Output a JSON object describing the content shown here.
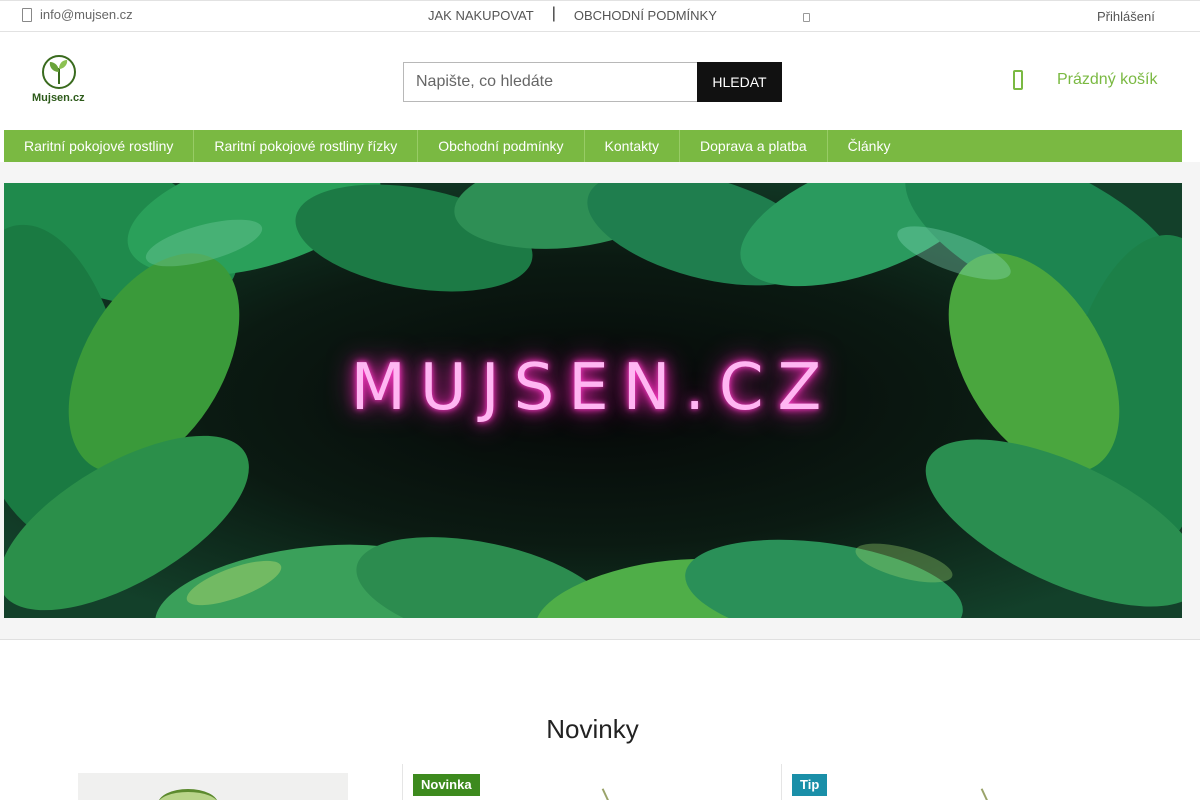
{
  "topbar": {
    "email": "info@mujsen.cz",
    "links": [
      "JAK NAKUPOVAT",
      "OBCHODNÍ PODMÍNKY"
    ],
    "separator": "|",
    "login": "Přihlášení"
  },
  "header": {
    "logo_text": "Mujsen.cz",
    "search_placeholder": "Napište, co hledáte",
    "search_button": "HLEDAT",
    "cart_label": "Prázdný košík"
  },
  "nav": {
    "items": [
      "Raritní pokojové rostliny",
      "Raritní pokojové rostliny řízky",
      "Obchodní podmínky",
      "Kontakty",
      "Doprava a platba",
      "Články"
    ]
  },
  "banner": {
    "title": "MUJSEN.CZ"
  },
  "new_section": {
    "title": "Novinky",
    "products": [
      {
        "badge": ""
      },
      {
        "badge": "Novinka"
      },
      {
        "badge": "Tip"
      }
    ]
  },
  "colors": {
    "accent": "#7ab942",
    "badge_new": "#3d8a1e",
    "badge_tip": "#1a8fa8",
    "neon": "#ff3ec8"
  },
  "icons": {
    "contact": "mail-icon",
    "topbar_extra": "small-icon",
    "cart": "cart-icon",
    "logo": "plant-sprout-icon"
  }
}
